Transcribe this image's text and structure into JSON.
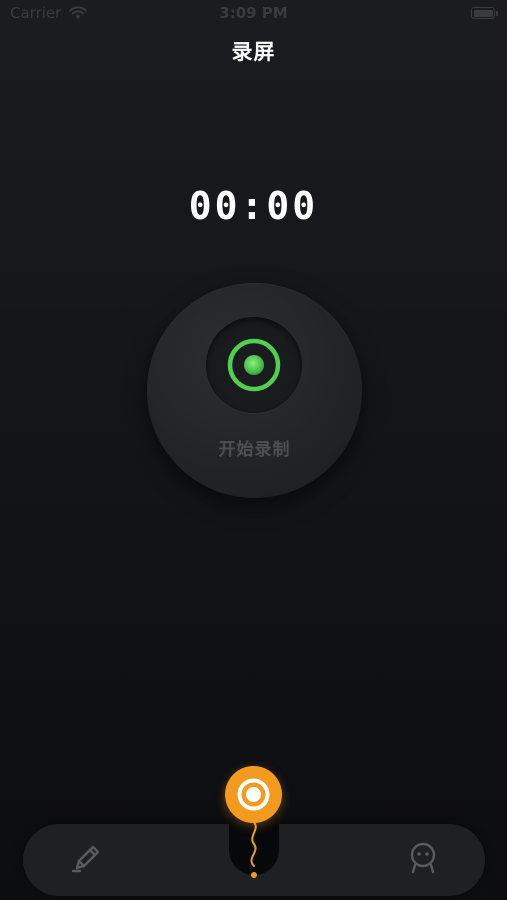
{
  "status_bar": {
    "carrier": "Carrier",
    "time": "3:09 PM",
    "wifi_icon": "wifi-icon",
    "battery_icon": "battery-icon"
  },
  "header": {
    "title": "录屏"
  },
  "timer": {
    "value": "00:00"
  },
  "record": {
    "label": "开始录制",
    "icon": "record-dot-icon",
    "accent_color": "#4fd14f"
  },
  "tab_bar": {
    "items": [
      {
        "icon": "pencil-icon",
        "active": false
      },
      {
        "icon": "record-icon",
        "active": true,
        "color": "#f39a1f"
      },
      {
        "icon": "user-icon",
        "active": false
      }
    ]
  }
}
